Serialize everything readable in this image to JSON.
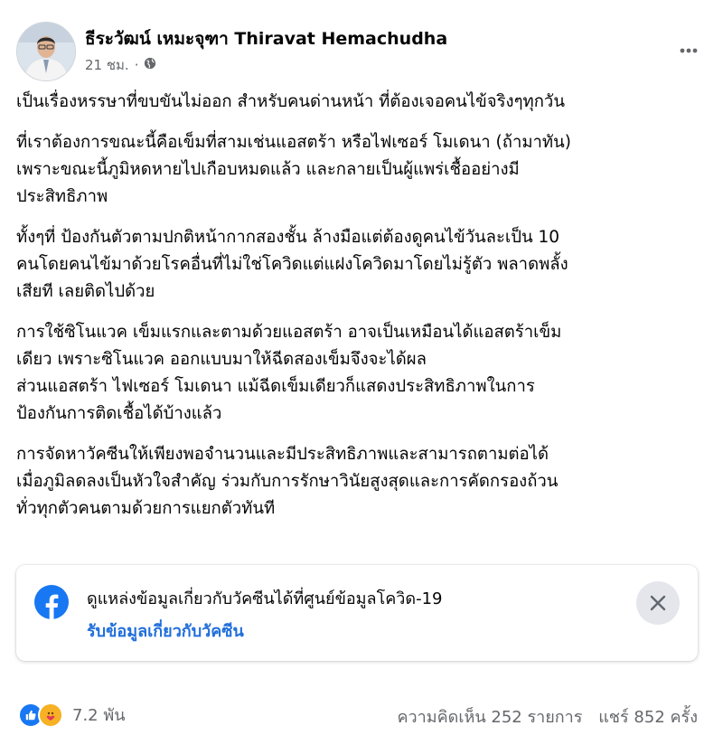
{
  "post": {
    "author": "ธีระวัฒน์ เหมะจุฑา Thiravat Hemachudha",
    "time": "21 ชม.",
    "audience_icon": "globe-icon",
    "paragraphs": [
      [
        "เป็นเรื่องหรรษาที่ขบขันไม่ออก สำหรับคนด่านหน้า ที่ต้องเจอคนไข้จริงๆทุกวัน"
      ],
      [
        "ที่เราต้องการขณะนี้คือเข็มที่สามเช่นแอสตร้า หรือไฟเซอร์ โมเดนา (ถ้ามาทัน)",
        "เพราะขณะนี้ภูมิหดหายไปเกือบหมดแล้ว และกลายเป็นผู้แพร่เชื้ออย่างมี",
        "ประสิทธิภาพ"
      ],
      [
        "ทั้งๆที่ ป้องกันตัวตามปกติหน้ากากสองชั้น ล้างมือแต่ต้องดูคนไข้วันละเป็น 10",
        "คนโดยคนไข้มาด้วยโรคอื่นที่ไม่ใช่โควิดแต่แฝงโควิดมาโดยไม่รู้ตัว พลาดพลั้ง",
        "เสียที เลยติดไปด้วย"
      ],
      [
        "การใช้ซิโนแวค เข็มแรกและตามด้วยแอสตร้า อาจเป็นเหมือนได้แอสตร้าเข็ม",
        "เดียว เพราะซิโนแวค ออกแบบมาให้ฉีดสองเข็มจึงจะได้ผล",
        "ส่วนแอสตร้า ไฟเซอร์ โมเดนา  แม้ฉีดเข็มเดียวก็แสดงประสิทธิภาพในการ",
        "ป้องกันการติดเชื้อได้บ้างแล้ว"
      ],
      [
        "การจัดหาวัคซีนให้เพียงพอจำนวนและมีประสิทธิภาพและสามารถตามต่อได้",
        "เมื่อภูมิลดลงเป็นหัวใจสำคัญ ร่วมกับการรักษาวินัยสูงสุดและการคัดกรองถ้วน",
        "ทั่วทุกตัวคนตามด้วยการแยกตัวทันที"
      ]
    ]
  },
  "info_card": {
    "text": "ดูแหล่งข้อมูลเกี่ยวกับวัคซีนได้ที่ศูนย์ข้อมูลโควิด-19",
    "link": "รับข้อมูลเกี่ยวกับวัคซีน",
    "logo_icon": "facebook-logo-icon",
    "close_icon": "close-icon"
  },
  "footer": {
    "reaction_icons": [
      "like-icon",
      "care-icon"
    ],
    "reaction_count": "7.2 พัน",
    "comments": "ความคิดเห็น 252 รายการ",
    "shares": "แชร์ 852 ครั้ง"
  },
  "colors": {
    "link": "#216fdb",
    "facebook_blue": "#1877f2",
    "secondary_text": "#65676b",
    "like": "#1877f2",
    "care": "#f7b125"
  }
}
